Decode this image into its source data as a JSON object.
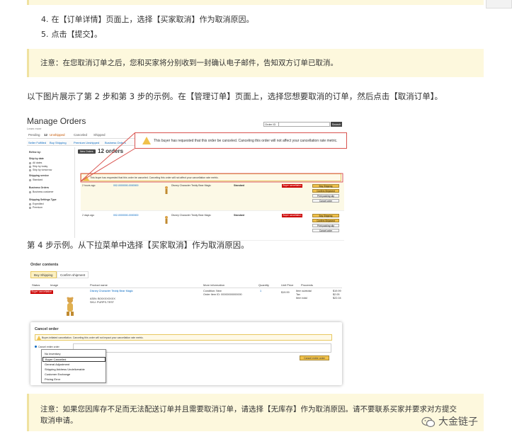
{
  "steps": [
    {
      "num": "4.",
      "text": "在【订单详情】页面上，选择【买家取消】作为取消原因。"
    },
    {
      "num": "5.",
      "text": "点击【提交】。"
    }
  ],
  "note1": {
    "label": "注意：",
    "text": "在您取消订单之后，您和买家将分别收到一封确认电子邮件，告知双方订单已取消。"
  },
  "para1": "以下图片展示了第 2 步和第 3 步的示例。在【管理订单】页面上，选择您想要取消的订单，然后点击【取消订单】。",
  "shot1": {
    "title": "Manage Orders",
    "subtitle": "Learn more",
    "search_select": "Order ID",
    "search_button": "Search",
    "tabs": [
      "Pending",
      "Unshipped",
      "Canceled",
      "Shipped"
    ],
    "unshipped_count": "12",
    "subtabs": [
      "Seller Fulfilled",
      "Buy Shipping",
      "Premium Unshipped",
      "Business Orders"
    ],
    "sidebar": [
      {
        "text": "Refine by:",
        "head": true
      },
      {
        "text": "Ship by date",
        "head": true
      },
      {
        "text": "All dates",
        "radio": true
      },
      {
        "text": "Ship by today",
        "radio": true
      },
      {
        "text": "Ship by tomorrow",
        "radio": true
      },
      {
        "text": "Shipping service",
        "head": true
      },
      {
        "text": "Standard",
        "radio": true
      },
      {
        "text": "Business Orders",
        "head": true
      },
      {
        "text": "Business customer",
        "radio": true
      },
      {
        "text": "Shipping Settings Type",
        "head": true
      },
      {
        "text": "Expedited",
        "radio": true
      },
      {
        "text": "Premium",
        "radio": true
      }
    ],
    "pill": "New Orders",
    "orders_count": "12 orders",
    "warn_small": "This buyer has requested that this order be canceled. Canceling this order will not affect your cancellation rate metric.",
    "callout_text": "This buyer has requested that this order be canceled. Canceling this order will not affect your cancellation rate metric.",
    "rows": [
      {
        "date": "2 hours ago",
        "order_id": "002-0000000-0000000",
        "product": "Disney Character Teddy Bear Magic",
        "service": "Standard",
        "badge": "Buyer cancellation",
        "btn1": "Buy Shipping",
        "btn2": "Confirm Shipment",
        "btn3": "Print packing slip",
        "btn4": "Cancel order"
      },
      {
        "date": "2 days ago",
        "order_id": "002-0000000-0000000",
        "product": "Disney Character Teddy Bear Magic",
        "service": "Standard",
        "badge": "Buyer cancellation",
        "btn1": "Buy Shipping",
        "btn2": "Confirm Shipment",
        "btn3": "Print packing slip",
        "btn4": "Cancel order"
      }
    ]
  },
  "caption4": "第 4 步示例。从下拉菜单中选择【买家取消】作为取消原因。",
  "shot2": {
    "title": "Order contents",
    "tab_active": "Buy Shipping",
    "tab_other": "Confirm shipment",
    "headers": [
      "Status",
      "Image",
      "Product name",
      "More information",
      "Quantity",
      "Unit Price",
      "Proceeds"
    ],
    "badge": "Buyer cancellation",
    "product": "Disney Character Teddy Bear Magic",
    "asin": "ASIN: B0XXXXXXXX",
    "sku": "SKU: PURPS-TEST",
    "info1": "Condition: New",
    "info2": "Order Item ID: 00000000000000",
    "qty": "1",
    "price": "$19.99",
    "proceeds": [
      [
        "Item subtotal",
        "$19.99"
      ],
      [
        "Tax",
        "$2.05"
      ],
      [
        "Item total",
        "$22.04"
      ]
    ],
    "modal_title": "Cancel order",
    "modal_warn": "Buyer-initiated cancellation. Canceling this order will not impact your cancellation rate metric.",
    "dd_label": "Cancel entire order",
    "options": [
      "No inventory",
      "Buyer Cancelled",
      "General Adjustment",
      "Shipping Address Undeliverable",
      "Customer Exchange",
      "Pricing Error"
    ],
    "selected_index": 1,
    "cancel_button": "Cancel entire order"
  },
  "note2": {
    "label": "注意：",
    "line1": "如果您因库存不足而无法配送订单并且需要取消订单，请选择【无库存】作为取消原因。请不要联系买家并要求对方提交",
    "line2": "取消申请。"
  },
  "watermark": "大金链子",
  "colors": {
    "note_bg": "#fdf8dd",
    "note_border": "#f0e2a0",
    "amazon_yellow": "#f0c14b",
    "callout_red": "#d9534f"
  }
}
